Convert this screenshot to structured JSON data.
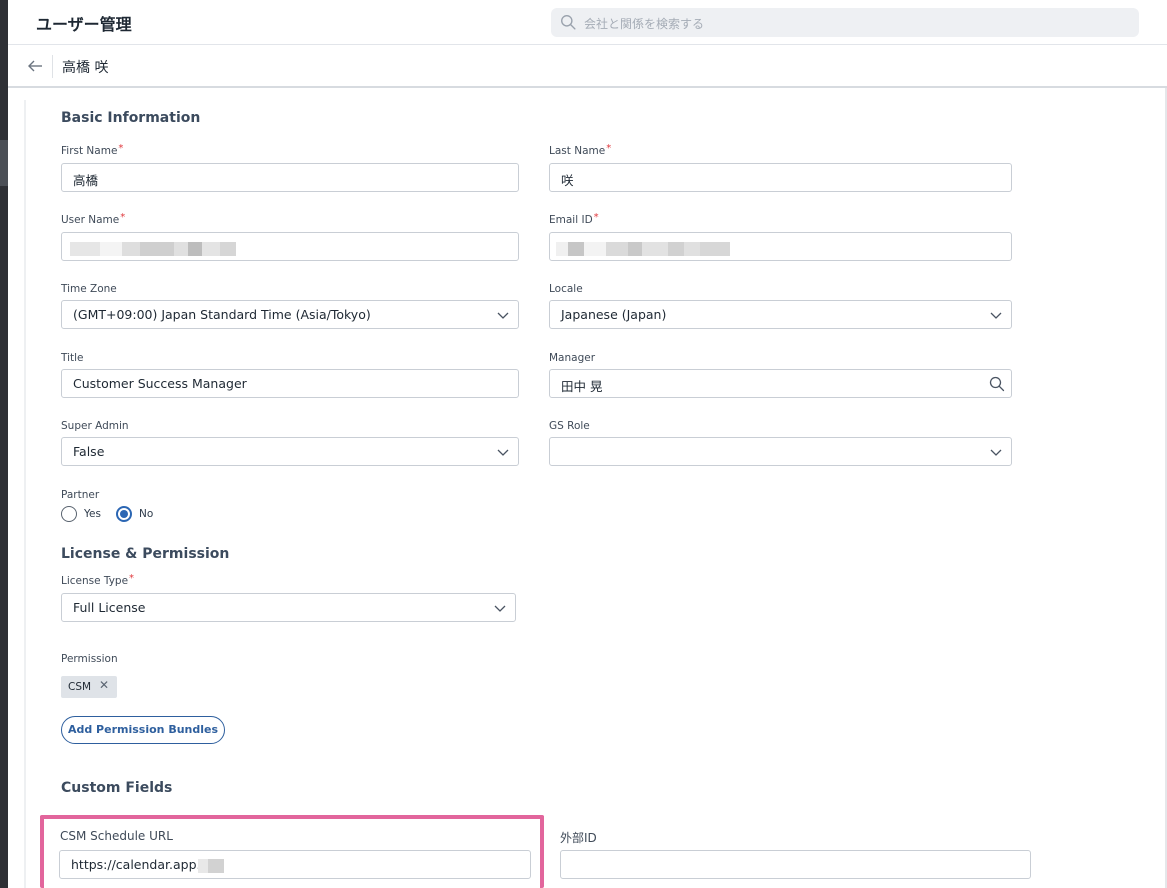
{
  "app": {
    "title": "ユーザー管理"
  },
  "search": {
    "placeholder": "会社と関係を検索する"
  },
  "subheader": {
    "user_name": "高橋 咲"
  },
  "basic_info": {
    "title": "Basic Information",
    "first_name": {
      "label": "First Name",
      "value": "高橋"
    },
    "last_name": {
      "label": "Last Name",
      "value": "咲"
    },
    "user_name": {
      "label": "User Name",
      "value": ""
    },
    "email_id": {
      "label": "Email ID",
      "value": ""
    },
    "time_zone": {
      "label": "Time Zone",
      "value": "(GMT+09:00) Japan Standard Time (Asia/Tokyo)"
    },
    "locale": {
      "label": "Locale",
      "value": "Japanese (Japan)"
    },
    "title_field": {
      "label": "Title",
      "value": "Customer Success Manager"
    },
    "manager": {
      "label": "Manager",
      "value": "田中 晃"
    },
    "super_admin": {
      "label": "Super Admin",
      "value": "False"
    },
    "gs_role": {
      "label": "GS Role",
      "value": ""
    },
    "partner": {
      "label": "Partner",
      "options": [
        "Yes",
        "No"
      ],
      "selected": "No"
    },
    "required_mark": "*"
  },
  "license": {
    "title": "License & Permission",
    "license_type": {
      "label": "License Type",
      "value": "Full License"
    },
    "permission": {
      "label": "Permission",
      "chips": [
        "CSM"
      ]
    },
    "add_bundles_label": "Add Permission Bundles"
  },
  "custom_fields": {
    "title": "Custom Fields",
    "csm_schedule_url": {
      "label": "CSM Schedule URL",
      "value": "https://calendar.app.("
    },
    "external_id": {
      "label": "外部ID",
      "value": ""
    }
  },
  "colors": {
    "accent": "#2b66b3",
    "required": "#e0393e",
    "highlight": "#e2659c",
    "sidebar": "#2e3035"
  },
  "icons": {
    "search": "search-icon",
    "back": "arrow-left-icon",
    "dropdown": "chevron-down-icon",
    "lookup": "magnifier-icon",
    "remove": "close-icon"
  }
}
